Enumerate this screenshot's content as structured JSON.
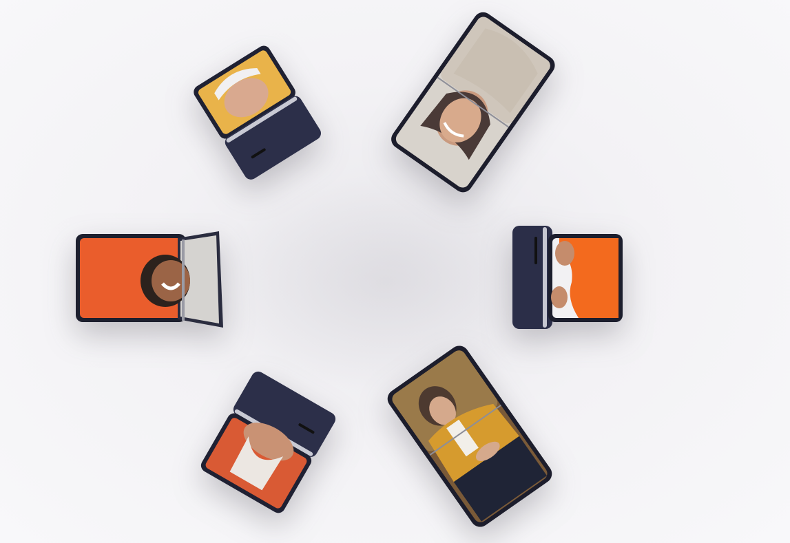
{
  "scene": {
    "background": "#f4f3f6",
    "devices": [
      {
        "name": "phone-top-left",
        "state": "half-folded",
        "body_color": "#2a2d45",
        "screen_content": "person-yellow-background"
      },
      {
        "name": "phone-top-right",
        "state": "half-folded",
        "body_color": "#2a2d45",
        "screen_content": "woman-smiling-beige-sweater"
      },
      {
        "name": "phone-middle-left",
        "state": "half-folded",
        "body_color": "#2a2d45",
        "screen_content": "woman-laughing-orange-hoodie"
      },
      {
        "name": "phone-middle-right",
        "state": "half-folded",
        "body_color": "#2a2d45",
        "screen_content": "orange-clothing-closeup"
      },
      {
        "name": "phone-bottom-left",
        "state": "half-folded",
        "body_color": "#2a2d45",
        "screen_content": "person-orange-top"
      },
      {
        "name": "phone-bottom-right",
        "state": "half-folded",
        "body_color": "#2a2d45",
        "screen_content": "young-man-mustard-jacket"
      }
    ]
  }
}
